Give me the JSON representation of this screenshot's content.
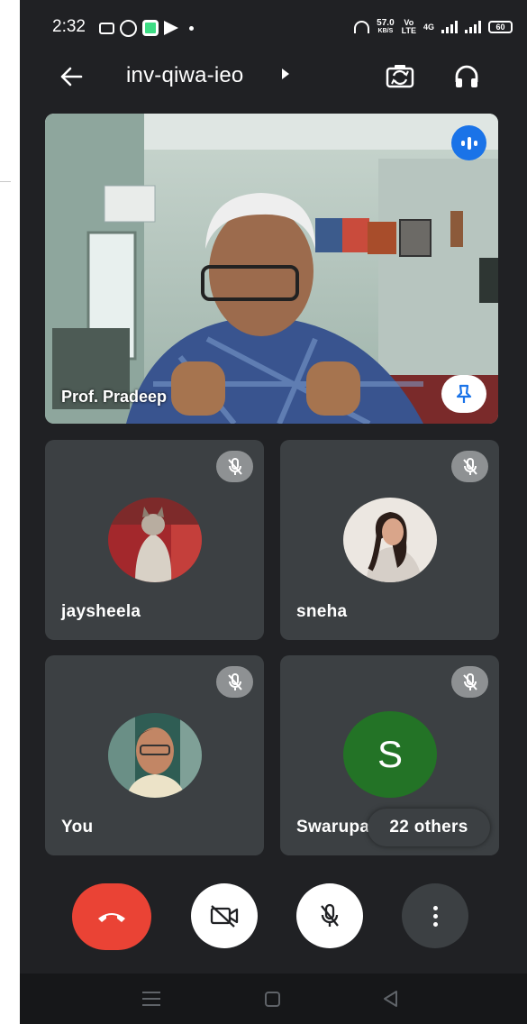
{
  "status_bar": {
    "time": "2:32",
    "icons_left": [
      "cast-icon",
      "whatsapp-icon",
      "messages-icon",
      "telegram-icon",
      "notification-dot"
    ],
    "speed_value": "57.0",
    "speed_unit": "KB/S",
    "volte_top": "Vo",
    "volte_bottom": "LTE",
    "network": "4G",
    "battery": "60"
  },
  "app_bar": {
    "meeting_code": "inv-qiwa-ieo",
    "icons": [
      "back-arrow-icon",
      "caret-right-icon",
      "switch-camera-icon",
      "headphones-icon"
    ]
  },
  "main_speaker": {
    "name": "Prof. Pradeep",
    "speaking": true,
    "pin_icon": "pin-icon"
  },
  "participants": [
    {
      "name": "jaysheela",
      "muted": true,
      "avatar": "cat-photo"
    },
    {
      "name": "sneha",
      "muted": true,
      "avatar": "girl-photo"
    },
    {
      "name": "You",
      "muted": true,
      "avatar": "man-photo"
    },
    {
      "name": "Swarupa",
      "muted": true,
      "initial": "S",
      "avatar_color": "#237326"
    }
  ],
  "others_label": "22 others",
  "controls": {
    "end_call_icon": "end-call-icon",
    "camera_icon": "camera-off-icon",
    "mic_icon": "mic-off-icon",
    "more_icon": "more-vert-icon"
  },
  "colors": {
    "background": "#202124",
    "tile": "#3c4043",
    "end_call": "#ea4335",
    "speaking": "#1a73e8"
  }
}
